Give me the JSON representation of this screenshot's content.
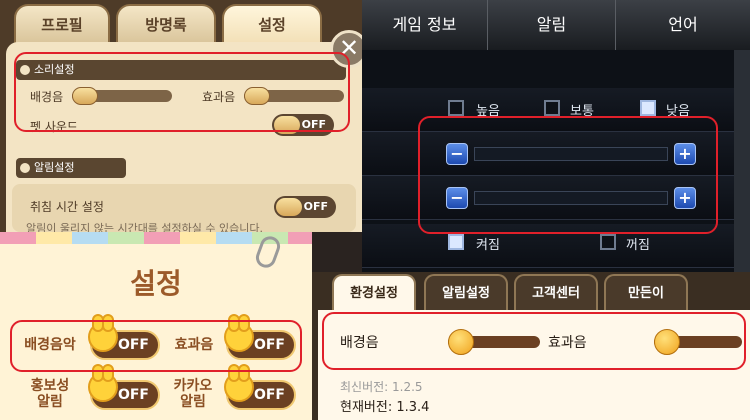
{
  "panel_a": {
    "tabs": [
      {
        "label": "프로필"
      },
      {
        "label": "방명록"
      },
      {
        "label": "설정"
      }
    ],
    "sound_section": {
      "title": "소리설정",
      "bgm_label": "배경음",
      "sfx_label": "효과음",
      "pet_sound_label": "펫 사운드",
      "pet_sound_state": "OFF",
      "bgm_level": 0.0,
      "sfx_level": 0.0
    },
    "alarm_section": {
      "title": "알림설정",
      "sleep_time_label": "취침 시간 설정",
      "sleep_time_state": "OFF",
      "sleep_time_hint": "알림이 울리지 않는 시간대를 설정하실 수 있습니다."
    },
    "close_glyph": "✕"
  },
  "panel_b": {
    "tabs": [
      {
        "label": "게임 정보"
      },
      {
        "label": "알림"
      },
      {
        "label": "언어"
      }
    ],
    "quality_options": [
      {
        "label": "높음",
        "checked": false
      },
      {
        "label": "보통",
        "checked": false
      },
      {
        "label": "낮음",
        "checked": true
      }
    ],
    "minus_glyph": "−",
    "plus_glyph": "+",
    "volume_levels": [
      0.0,
      0.0
    ],
    "power_options": [
      {
        "label": "켜짐",
        "checked": true
      },
      {
        "label": "꺼짐",
        "checked": false
      }
    ]
  },
  "panel_c": {
    "title": "설정",
    "toggles": [
      {
        "label": "배경음악",
        "state": "OFF"
      },
      {
        "label": "효과음",
        "state": "OFF"
      },
      {
        "label": "홍보성\n알림",
        "state": "OFF"
      },
      {
        "label": "카카오\n알림",
        "state": "OFF"
      }
    ]
  },
  "panel_d": {
    "tabs": [
      {
        "label": "환경설정"
      },
      {
        "label": "알림설정"
      },
      {
        "label": "고객센터"
      },
      {
        "label": "만든이"
      }
    ],
    "bgm_label": "배경음",
    "sfx_label": "효과음",
    "bgm_level": 0.0,
    "sfx_level": 0.0,
    "latest_version": "최신버전: 1.2.5",
    "current_version": "현재버전: 1.3.4"
  },
  "colors": {
    "highlight": "#e0202a"
  }
}
